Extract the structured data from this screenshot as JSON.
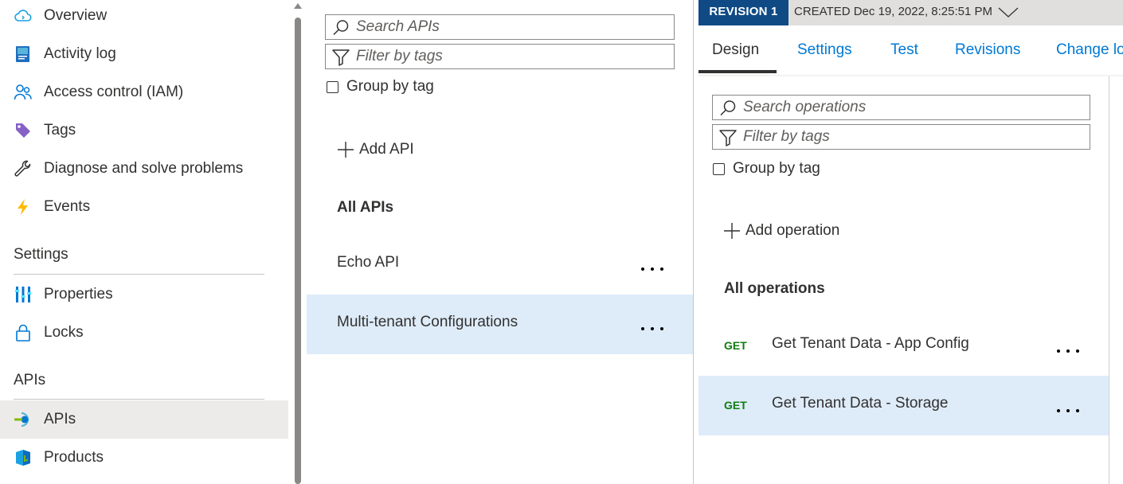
{
  "sidebar": {
    "items": [
      {
        "label": "Overview",
        "icon": "cloud-icon"
      },
      {
        "label": "Activity log",
        "icon": "activity-log-icon"
      },
      {
        "label": "Access control (IAM)",
        "icon": "people-icon"
      },
      {
        "label": "Tags",
        "icon": "tag-icon"
      },
      {
        "label": "Diagnose and solve problems",
        "icon": "wrench-icon"
      },
      {
        "label": "Events",
        "icon": "lightning-icon"
      }
    ],
    "settings_header": "Settings",
    "settings_items": [
      {
        "label": "Properties",
        "icon": "properties-icon"
      },
      {
        "label": "Locks",
        "icon": "lock-icon"
      }
    ],
    "apis_header": "APIs",
    "apis_items": [
      {
        "label": "APIs",
        "icon": "api-icon",
        "selected": true
      },
      {
        "label": "Products",
        "icon": "products-icon"
      }
    ]
  },
  "api_panel": {
    "search_placeholder": "Search APIs",
    "filter_placeholder": "Filter by tags",
    "group_by_tag": "Group by tag",
    "add_api": "Add API",
    "all_apis": "All APIs",
    "apis": [
      {
        "label": "Echo API",
        "selected": false
      },
      {
        "label": "Multi-tenant Configurations",
        "selected": true
      }
    ]
  },
  "revision": {
    "badge": "REVISION 1",
    "created": "CREATED Dec 19, 2022, 8:25:51 PM"
  },
  "tabs": [
    {
      "label": "Design",
      "active": true
    },
    {
      "label": "Settings",
      "active": false
    },
    {
      "label": "Test",
      "active": false
    },
    {
      "label": "Revisions",
      "active": false
    },
    {
      "label": "Change lo",
      "active": false
    }
  ],
  "operations_panel": {
    "search_placeholder": "Search operations",
    "filter_placeholder": "Filter by tags",
    "group_by_tag": "Group by tag",
    "add_operation": "Add operation",
    "all_operations": "All operations",
    "operations": [
      {
        "verb": "GET",
        "label": "Get Tenant Data - App Config",
        "selected": false
      },
      {
        "verb": "GET",
        "label": "Get Tenant Data - Storage",
        "selected": true
      }
    ]
  },
  "colors": {
    "accent": "#0078d4",
    "revision_badge": "#0f4a85",
    "selection": "#deecf9",
    "sidebar_selection": "#edebe9",
    "get_verb": "#107c10"
  }
}
